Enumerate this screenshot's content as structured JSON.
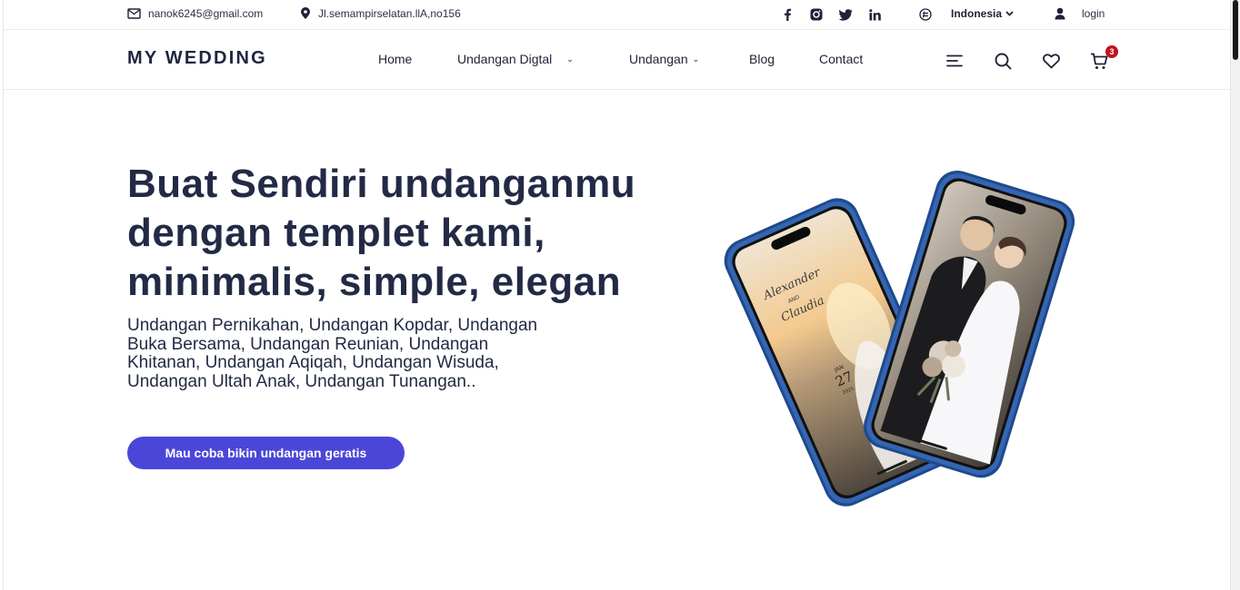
{
  "topbar": {
    "email": "nanok6245@gmail.com",
    "address": "Jl.semampirselatan.llA,no156",
    "socials": [
      "facebook-icon",
      "instagram-icon",
      "twitter-icon",
      "linkedin-icon"
    ],
    "language": "Indonesia",
    "login": "login"
  },
  "nav": {
    "brand": "MY WEDDING",
    "links": [
      {
        "label": "Home"
      },
      {
        "label": "Undangan Digtal",
        "dropdown": true
      },
      {
        "label": "Undangan",
        "dropdown": true
      },
      {
        "label": "Blog"
      },
      {
        "label": "Contact"
      }
    ],
    "cart_count": "3"
  },
  "hero": {
    "title": "Buat Sendiri undanganmu dengan templet kami, minimalis, simple, elegan",
    "subtitle": "Undangan Pernikahan, Undangan Kopdar, Undangan Buka Bersama, Undangan Reunian, Undangan Khitanan, Undangan Aqiqah, Undangan Wisuda, Undangan Ultah Anak, Undangan Tunangan..",
    "cta": "Mau coba bikin undangan geratis"
  },
  "phone_card": {
    "name1": "Alexander",
    "and": "AND",
    "name2": "Claudia",
    "month": "JAN",
    "day": "27",
    "year": "2025"
  },
  "colors": {
    "accent": "#4a47d8",
    "text": "#222a45",
    "badge": "#c1121f",
    "phone_frame": "#2f5ea8"
  }
}
